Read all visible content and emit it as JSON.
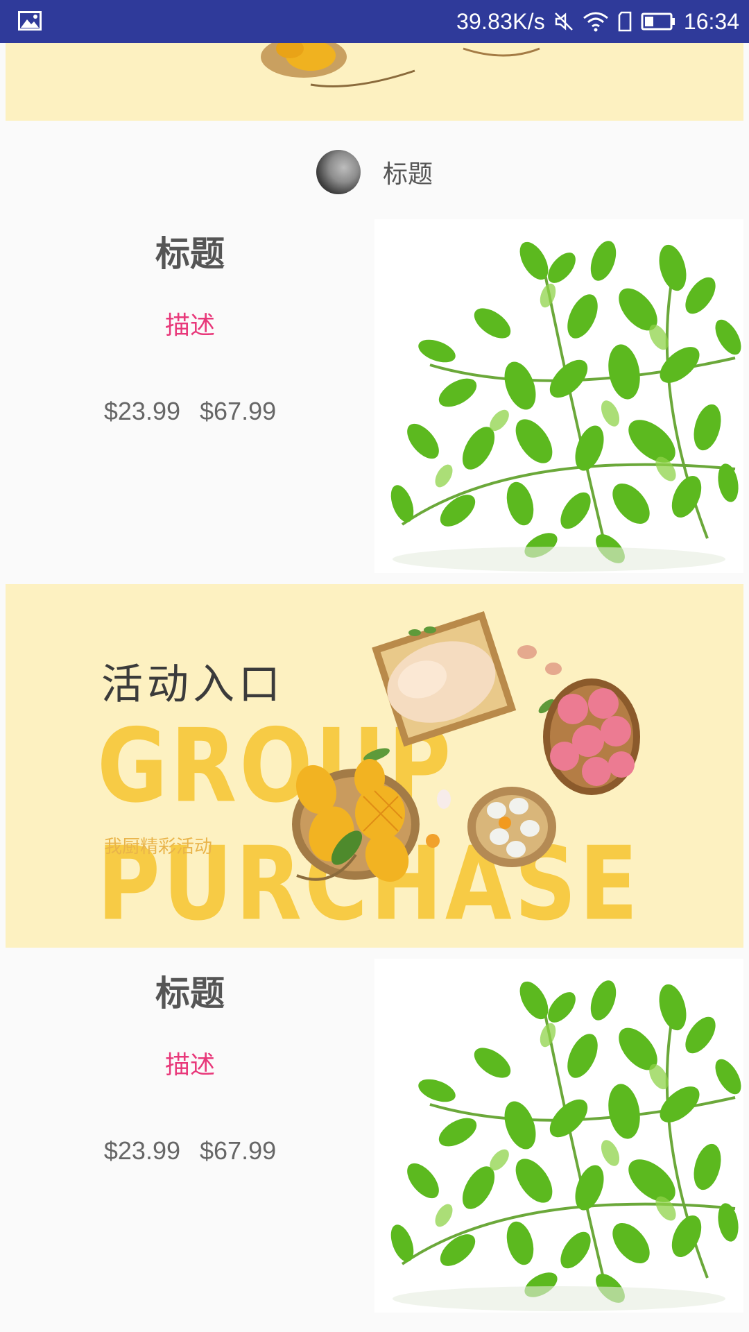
{
  "status_bar": {
    "net_speed": "39.83K/s",
    "time": "16:34",
    "icons": [
      "gallery-icon",
      "mute-icon",
      "wifi-icon",
      "sim-icon",
      "battery-icon"
    ],
    "background": "#2f3a9a"
  },
  "section_header": {
    "icon": "moon-icon",
    "title": "标题"
  },
  "cards": [
    {
      "title": "标题",
      "desc": "描述",
      "price": "$23.99",
      "original_price": "$67.99",
      "image": "green-herb-image"
    },
    {
      "title": "标题",
      "desc": "描述",
      "price": "$23.99",
      "original_price": "$67.99",
      "image": "green-herb-image"
    }
  ],
  "banner": {
    "headline": "活动入口",
    "big_text": "GROUP PURCHASE",
    "sub": "我厨精彩活动",
    "background": "#fdf1c1",
    "accent": "#f7cb45"
  },
  "colors": {
    "desc": "#e8387a",
    "title": "#555555",
    "price": "#666666"
  }
}
